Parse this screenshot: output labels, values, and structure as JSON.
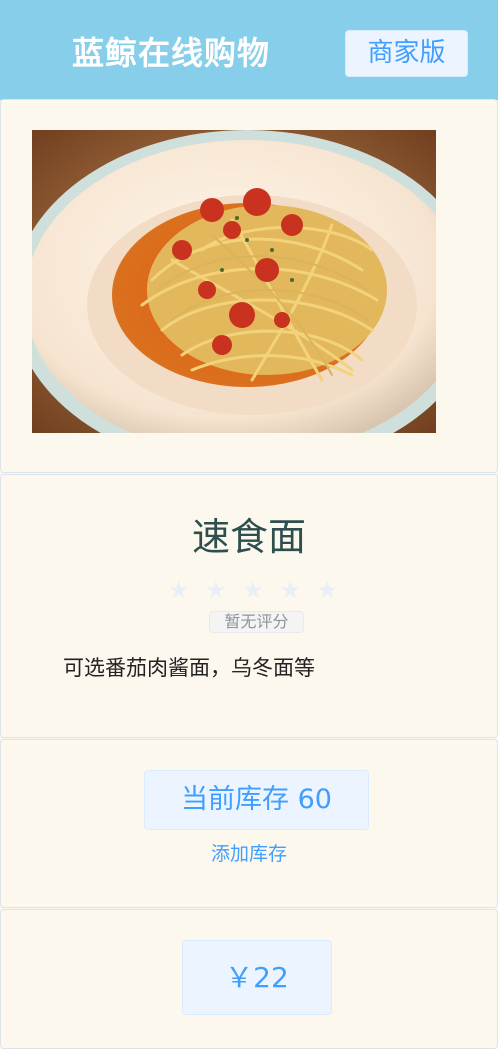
{
  "header": {
    "title": "蓝鲸在线购物",
    "merchant_button": "商家版"
  },
  "product": {
    "image_alt": "spaghetti-with-tomato-sauce",
    "name": "速食面",
    "rating_stars": [
      "★",
      "★",
      "★",
      "★",
      "★"
    ],
    "rating_value": 0,
    "rating_label": "暂无评分",
    "description": "可选番茄肉酱面，乌冬面等"
  },
  "stock": {
    "label": "当前库存 60",
    "add_link": "添加库存"
  },
  "price": {
    "label": "￥22"
  },
  "colors": {
    "header_bg": "#87ceeb",
    "page_bg": "#fdf8ee",
    "accent": "#409eff",
    "tag_bg": "#ecf5ff",
    "star_empty": "#e9eff7",
    "title_text": "#2f4f4f"
  }
}
